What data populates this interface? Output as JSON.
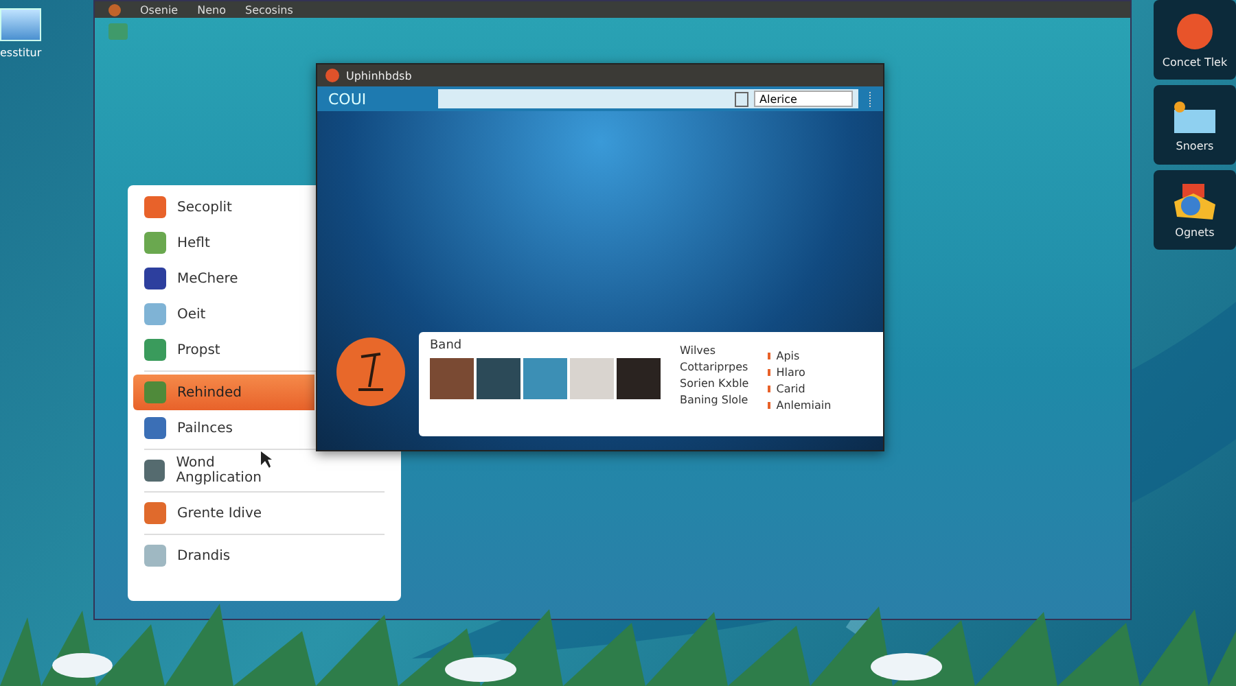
{
  "desktop": {
    "icon_label": "esstitur"
  },
  "menubar": {
    "items": [
      "Osenie",
      "Neno",
      "Secosins"
    ]
  },
  "side_tiles": [
    {
      "label": "Concet Tlek",
      "kind": "face"
    },
    {
      "label": "Snoers",
      "kind": "tray"
    },
    {
      "label": "Ognets",
      "kind": "shapes"
    }
  ],
  "app_menu": {
    "items": [
      {
        "label": "Secoplit",
        "selected": false,
        "divider_after": false,
        "color": "#e8622a"
      },
      {
        "label": "Heflt",
        "selected": false,
        "divider_after": false,
        "color": "#6aa84f"
      },
      {
        "label": "MeChere",
        "selected": false,
        "divider_after": false,
        "color": "#2d3f9e"
      },
      {
        "label": "Oeit",
        "selected": false,
        "divider_after": false,
        "color": "#7fb3d5"
      },
      {
        "label": "Propst",
        "selected": false,
        "divider_after": true,
        "color": "#3a9b5c"
      },
      {
        "label": "Rehinded",
        "selected": true,
        "divider_after": false,
        "color": "#4f8a3a"
      },
      {
        "label": "Pailnces",
        "selected": false,
        "divider_after": true,
        "color": "#3b6fb6"
      },
      {
        "label": "Wond Angplication",
        "selected": false,
        "divider_after": true,
        "color": "#556b6f"
      },
      {
        "label": "Grente Idive",
        "selected": false,
        "divider_after": true,
        "color": "#e06a2c"
      },
      {
        "label": "Drandis",
        "selected": false,
        "divider_after": false,
        "color": "#9fb8c2"
      }
    ]
  },
  "window": {
    "title": "Uphinhbdsb",
    "toolbar_label": "COUI",
    "search_value": "Alerice",
    "panel": {
      "heading": "Band",
      "list_1": [
        "Wilves",
        "Cottariprpes",
        "Sorien Kxble",
        "Baning Slole"
      ],
      "list_2": [
        "Apis",
        "Hlaro",
        "Carid",
        "Anlemiain"
      ]
    }
  }
}
